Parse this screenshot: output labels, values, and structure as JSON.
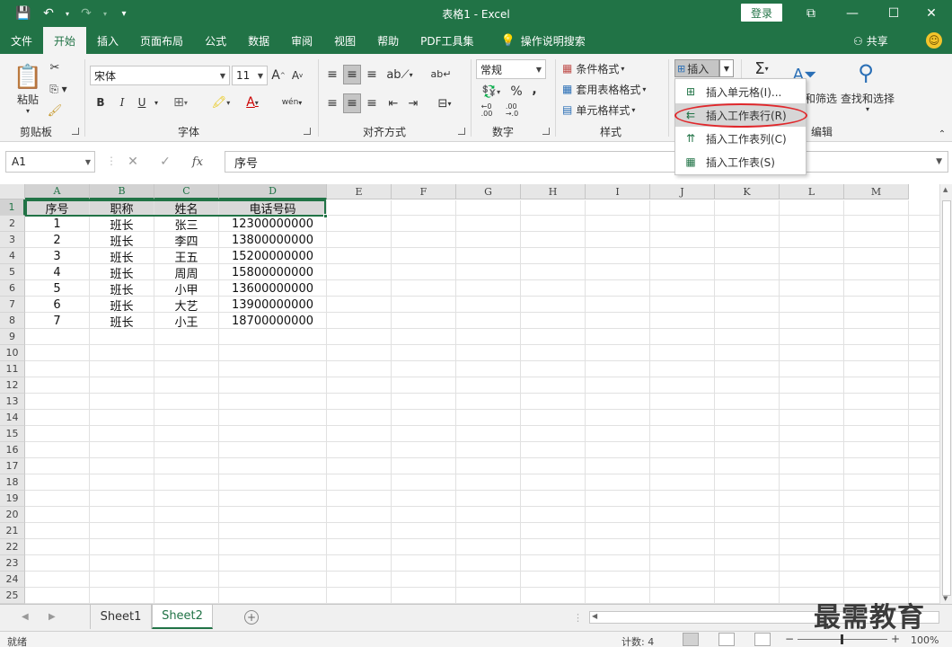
{
  "titlebar": {
    "title": "表格1  -  Excel",
    "login": "登录",
    "qat": {
      "save": "💾",
      "undo": "↶",
      "redo": "↷",
      "more": "▾"
    },
    "controls": {
      "restore": "⧉",
      "minimize": "—",
      "maximize": "☐",
      "close": "✕"
    }
  },
  "menu": {
    "tabs": [
      "文件",
      "开始",
      "插入",
      "页面布局",
      "公式",
      "数据",
      "审阅",
      "视图",
      "帮助",
      "PDF工具集",
      "操作说明搜索"
    ],
    "active_index": 1,
    "share": "共享"
  },
  "ribbon": {
    "clipboard": {
      "label": "剪贴板",
      "paste": "粘贴"
    },
    "font": {
      "label": "字体",
      "name": "宋体",
      "size": "11",
      "bold": "B",
      "italic": "I",
      "underline": "U",
      "grow": "A",
      "shrink": "A",
      "font_color": "A",
      "phonetic": "wén"
    },
    "alignment": {
      "label": "对齐方式"
    },
    "number": {
      "label": "数字",
      "format": "常规",
      "percent": "%",
      "comma": ",",
      "inc_dec": ".00 →.0",
      "dec_dec": ".00 →.0"
    },
    "styles": {
      "label": "样式",
      "conditional": "条件格式",
      "table_format": "套用表格格式",
      "cell_styles": "单元格样式"
    },
    "cells": {
      "insert": "插入"
    },
    "editing": {
      "label": "编辑",
      "sum": "Σ",
      "sort_filter": "和筛选",
      "find_select": "查找和选择"
    }
  },
  "dropdown": {
    "items": [
      {
        "label": "插入单元格(I)...",
        "icon": "insert-cells-icon"
      },
      {
        "label": "插入工作表行(R)",
        "icon": "insert-rows-icon"
      },
      {
        "label": "插入工作表列(C)",
        "icon": "insert-columns-icon"
      },
      {
        "label": "插入工作表(S)",
        "icon": "insert-sheet-icon"
      }
    ],
    "highlighted_index": 1,
    "annotation_color": "#e0282c"
  },
  "formula_bar": {
    "name_box": "A1",
    "cancel": "✕",
    "enter": "✓",
    "fx": "fx",
    "content": "序号"
  },
  "grid": {
    "columns": [
      "A",
      "B",
      "C",
      "D",
      "E",
      "F",
      "G",
      "H",
      "I",
      "J",
      "K",
      "L",
      "M"
    ],
    "rows": [
      "1",
      "2",
      "3",
      "4",
      "5",
      "6",
      "7",
      "8",
      "9",
      "10",
      "11",
      "12",
      "13",
      "14",
      "15",
      "16",
      "17",
      "18",
      "19",
      "20",
      "21",
      "22",
      "23",
      "24",
      "25"
    ],
    "header_row": [
      "序号",
      "职称",
      "姓名",
      "电话号码"
    ],
    "data": [
      [
        "1",
        "班长",
        "张三",
        "12300000000"
      ],
      [
        "2",
        "班长",
        "李四",
        "13800000000"
      ],
      [
        "3",
        "班长",
        "王五",
        "15200000000"
      ],
      [
        "4",
        "班长",
        "周周",
        "15800000000"
      ],
      [
        "5",
        "班长",
        "小甲",
        "13600000000"
      ],
      [
        "6",
        "班长",
        "大艺",
        "13900000000"
      ],
      [
        "7",
        "班长",
        "小王",
        "18700000000"
      ]
    ]
  },
  "sheets": {
    "tabs": [
      "Sheet1",
      "Sheet2"
    ],
    "active_index": 1,
    "add": "+"
  },
  "status": {
    "ready": "就绪",
    "count": "计数: 4",
    "zoom": "100%",
    "zoom_minus": "−",
    "zoom_plus": "+"
  },
  "watermark": "最需教育",
  "colors": {
    "accent": "#217346",
    "ribbon_bg": "#f3f3f3",
    "annotation": "#e0282c"
  }
}
